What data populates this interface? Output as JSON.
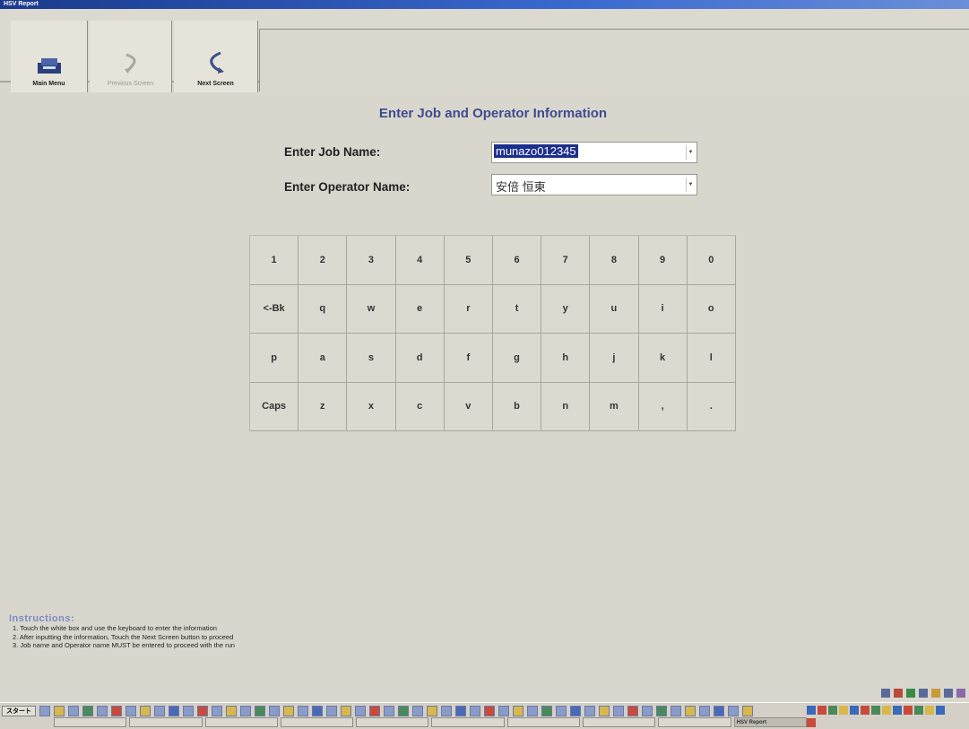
{
  "window": {
    "title": "HSV Report"
  },
  "toolbar": {
    "buttons": [
      {
        "label": "Main Menu",
        "icon": "main-menu-icon",
        "enabled": true
      },
      {
        "label": "Previous Screen",
        "icon": "previous-screen-icon",
        "enabled": false
      },
      {
        "label": "Next Screen",
        "icon": "next-screen-icon",
        "enabled": true
      }
    ]
  },
  "form": {
    "heading": "Enter Job and Operator Information",
    "job_label": "Enter Job Name:",
    "job_value": "munazo012345",
    "operator_label": "Enter Operator Name:",
    "operator_value": "安倍 恒東"
  },
  "keyboard": {
    "rows": [
      [
        "1",
        "2",
        "3",
        "4",
        "5",
        "6",
        "7",
        "8",
        "9",
        "0"
      ],
      [
        "<-Bk",
        "q",
        "w",
        "e",
        "r",
        "t",
        "y",
        "u",
        "i",
        "o"
      ],
      [
        "p",
        "a",
        "s",
        "d",
        "f",
        "g",
        "h",
        "j",
        "k",
        "l"
      ],
      [
        "Caps",
        "z",
        "x",
        "c",
        "v",
        "b",
        "n",
        "m",
        ",",
        "."
      ]
    ]
  },
  "instructions": {
    "title": "Instructions:",
    "lines": [
      "1. Touch the white box and use the keyboard to enter the information",
      "2. After inputting the information, Touch the Next Screen button to proceed",
      "3. Job name and Operator name MUST be entered to proceed with the run"
    ]
  },
  "taskbar": {
    "start_label": "スタート",
    "active_task": "HSV Report"
  },
  "colors": {
    "background": "#d9d6cd",
    "heading": "#3d4d8f",
    "selection": "#1c2f8e",
    "instructions_title": "#7a8bc4"
  }
}
